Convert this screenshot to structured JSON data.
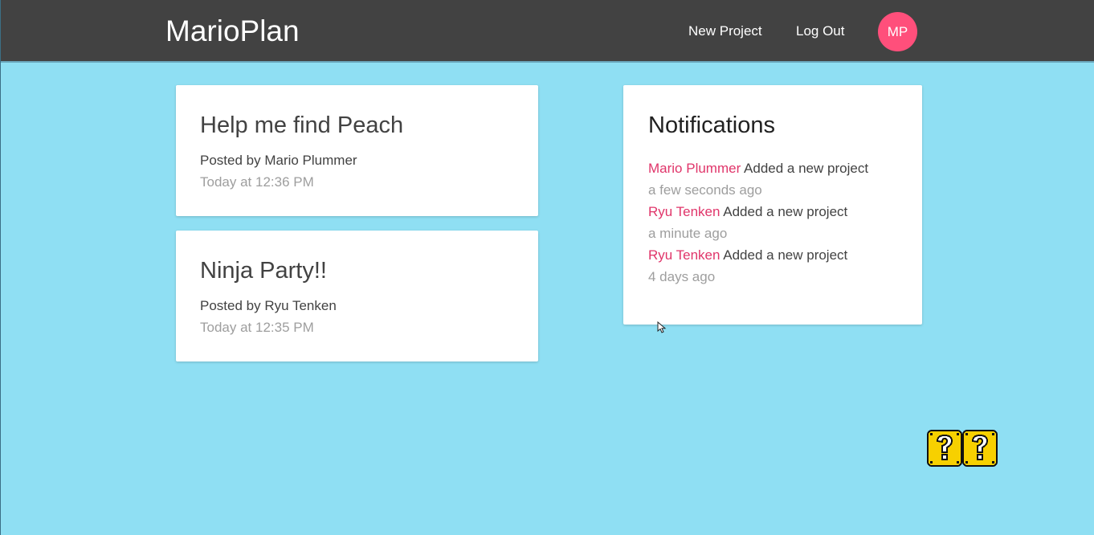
{
  "navbar": {
    "brand": "MarioPlan",
    "links": [
      "New Project",
      "Log Out"
    ],
    "avatar_initials": "MP",
    "avatar_color": "#ff4f7b"
  },
  "projects": [
    {
      "title": "Help me find Peach",
      "author_line": "Posted by Mario Plummer",
      "time": "Today at 12:36 PM"
    },
    {
      "title": "Ninja Party!!",
      "author_line": "Posted by Ryu Tenken",
      "time": "Today at 12:35 PM"
    }
  ],
  "notifications": {
    "title": "Notifications",
    "items": [
      {
        "user": "Mario Plummer",
        "action": "Added a new project",
        "time": "a few seconds ago"
      },
      {
        "user": "Ryu Tenken",
        "action": "Added a new project",
        "time": "a minute ago"
      },
      {
        "user": "Ryu Tenken",
        "action": "Added a new project",
        "time": "4 days ago"
      }
    ]
  },
  "colors": {
    "background": "#8fdff3",
    "navbar": "#424242",
    "accent_pink": "#e0356a"
  },
  "decorations": {
    "cursor_icon": "mouse-pointer-icon",
    "blocks_icon": "question-block-icon"
  }
}
